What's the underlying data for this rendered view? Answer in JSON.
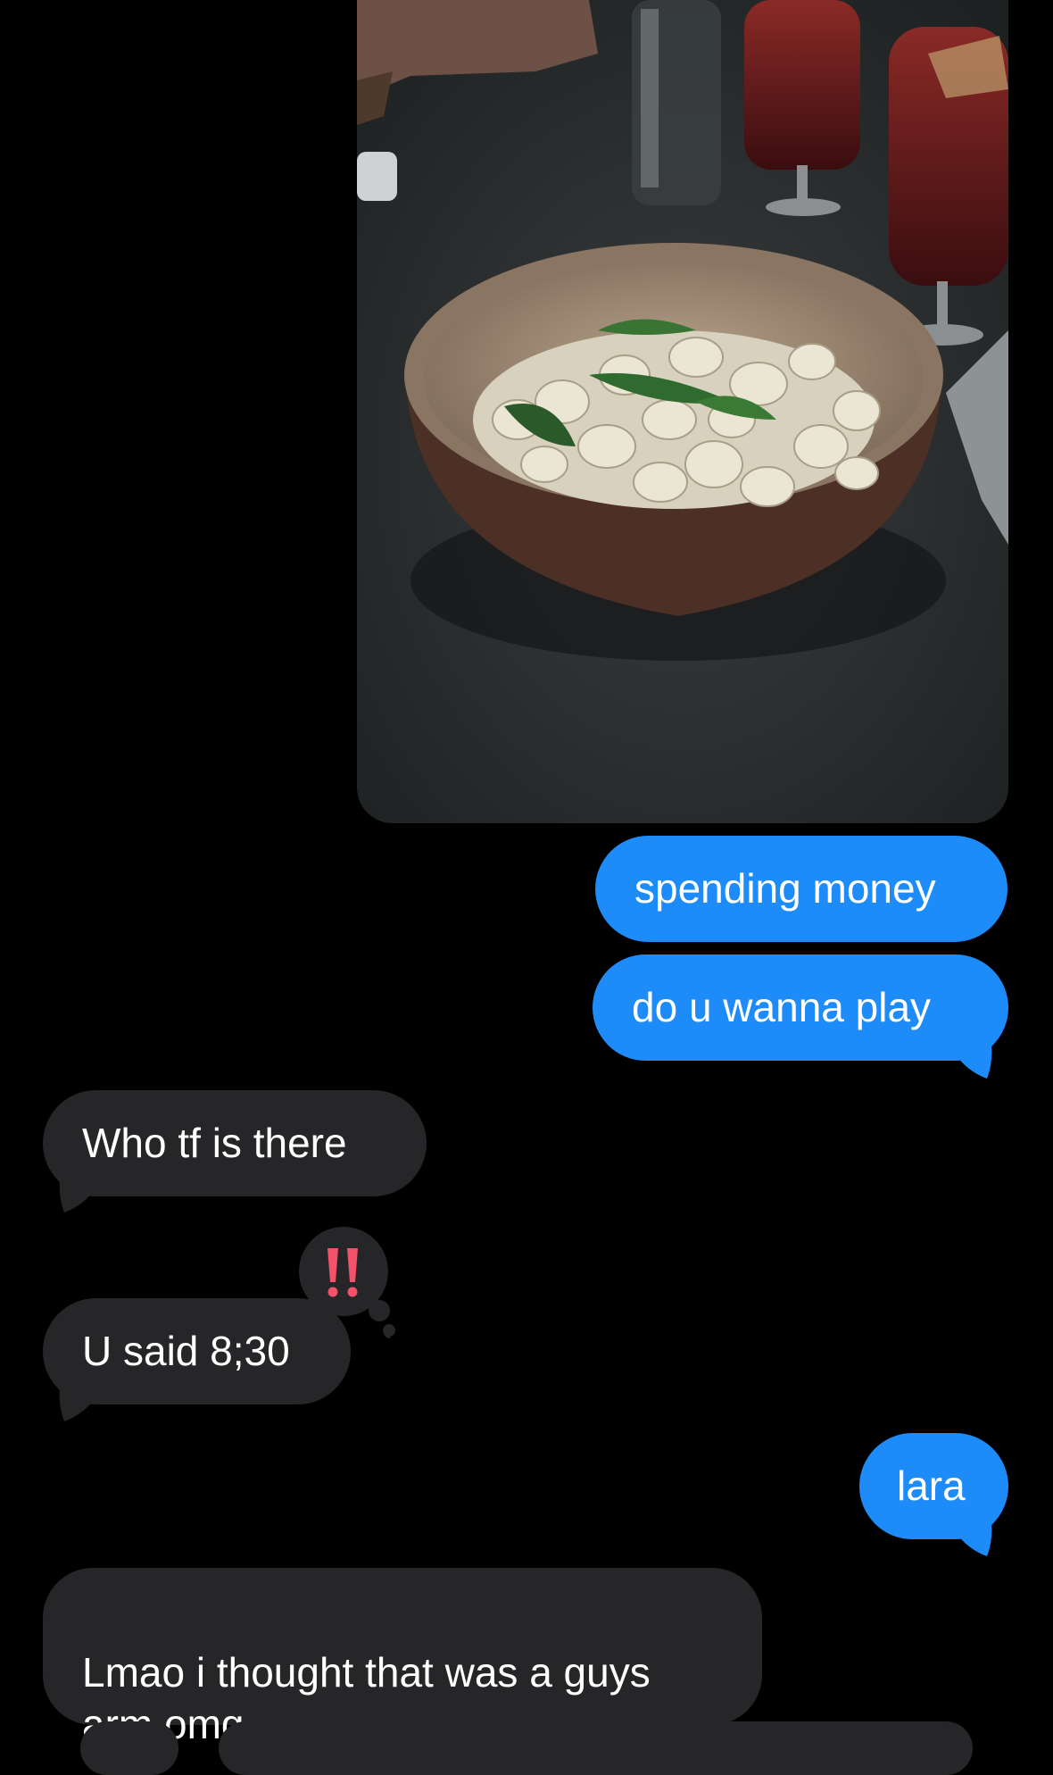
{
  "colors": {
    "background": "#000000",
    "sent_bubble": "#1d8bf8",
    "received_bubble": "#262628",
    "reaction_icon": "#f4526a"
  },
  "photo": {
    "icon": "food-photo"
  },
  "messages": [
    {
      "direction": "sent",
      "text": "spending money"
    },
    {
      "direction": "sent",
      "text": "do u wanna play"
    },
    {
      "direction": "received",
      "text": "Who tf is there"
    },
    {
      "direction": "received",
      "text": "U said 8;30",
      "reaction": "‼️"
    },
    {
      "direction": "sent",
      "text": "lara"
    },
    {
      "direction": "received",
      "text": "Lmao i thought that was a guys\narm omg"
    }
  ]
}
